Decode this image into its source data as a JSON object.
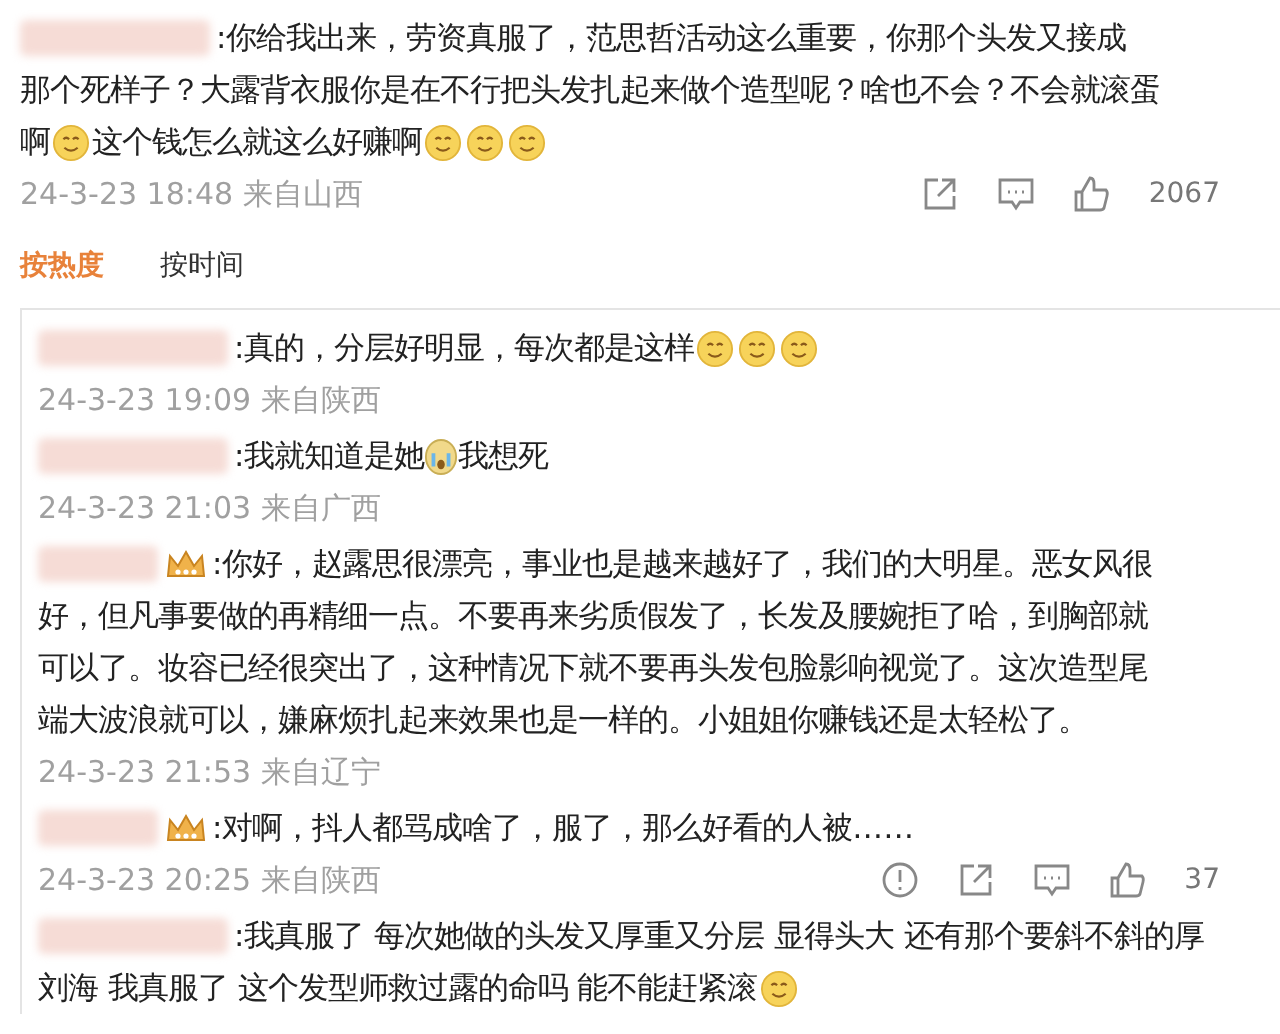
{
  "comment": {
    "lines": [
      [
        {
          "kind": "text",
          "text": ":你给我出来，劳资真服了，范思哲活动这么重要，你那个头发又接成"
        }
      ],
      [
        {
          "kind": "text",
          "text": "那个死样子？大露背衣服你是在不行把头发扎起来做个造型呢？啥也不会？不会就滚蛋"
        }
      ],
      [
        {
          "kind": "text",
          "text": "啊"
        },
        {
          "kind": "smile"
        },
        {
          "kind": "text",
          "text": "这个钱怎么就这么好赚啊"
        },
        {
          "kind": "smile"
        },
        {
          "kind": "smile"
        },
        {
          "kind": "smile"
        }
      ]
    ],
    "meta": "24-3-23 18:48 来自山西",
    "like_count": "2067"
  },
  "sort_tabs": [
    {
      "label": "按热度",
      "selected": true
    },
    {
      "label": "按时间",
      "selected": false
    }
  ],
  "replies": [
    {
      "badge": false,
      "lines": [
        [
          {
            "kind": "text",
            "text": ":真的，分层好明显，每次都是这样"
          },
          {
            "kind": "smile"
          },
          {
            "kind": "smile"
          },
          {
            "kind": "smile"
          }
        ]
      ],
      "meta": "24-3-23 19:09 来自陕西"
    },
    {
      "badge": false,
      "lines": [
        [
          {
            "kind": "text",
            "text": ":我就知道是她"
          },
          {
            "kind": "cry"
          },
          {
            "kind": "text",
            "text": "我想死"
          }
        ]
      ],
      "meta": "24-3-23 21:03 来自广西"
    },
    {
      "badge": true,
      "lines": [
        [
          {
            "kind": "text",
            "text": ":你好，赵露思很漂亮，事业也是越来越好了，我们的大明星。恶女风很"
          }
        ],
        [
          {
            "kind": "text",
            "text": "好，但凡事要做的再精细一点。不要再来劣质假发了，长发及腰婉拒了哈，到胸部就"
          }
        ],
        [
          {
            "kind": "text",
            "text": "可以了。妆容已经很突出了，这种情况下就不要再头发包脸影响视觉了。这次造型尾"
          }
        ],
        [
          {
            "kind": "text",
            "text": "端大波浪就可以，嫌麻烦扎起来效果也是一样的。小姐姐你赚钱还是太轻松了。"
          }
        ]
      ],
      "meta": "24-3-23 21:53 来自辽宁"
    },
    {
      "badge": true,
      "lines": [
        [
          {
            "kind": "text",
            "text": ":对啊，抖人都骂成啥了，服了，那么好看的人被……"
          }
        ]
      ],
      "meta": "24-3-23 20:25 来自陕西",
      "like_count": "37"
    },
    {
      "badge": false,
      "lines": [
        [
          {
            "kind": "text",
            "text": ":我真服了 每次她做的头发又厚重又分层 显得头大 还有那个要斜不斜的厚"
          }
        ],
        [
          {
            "kind": "text",
            "text": "刘海 我真服了 这个发型师救过露的命吗 能不能赶紧滚"
          },
          {
            "kind": "smile"
          }
        ]
      ]
    }
  ]
}
